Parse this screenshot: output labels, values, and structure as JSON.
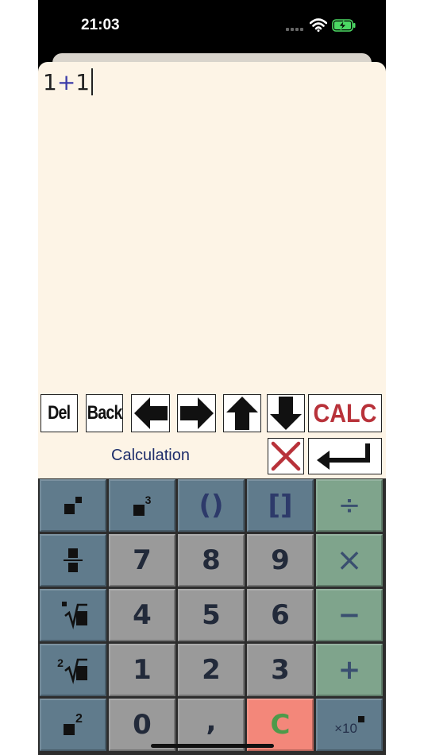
{
  "status_bar": {
    "time": "21:03"
  },
  "editor": {
    "operand_left": "1",
    "operator": "+",
    "operand_right": "1"
  },
  "toolbar": {
    "del_label": "Del",
    "back_label": "Back",
    "calc_label": "CALC"
  },
  "mode_label": "Calculation",
  "keypad": {
    "digits": [
      "7",
      "8",
      "9",
      "4",
      "5",
      "6",
      "1",
      "2",
      "3",
      "0"
    ],
    "paren_label": "()",
    "bracket_label": "[]",
    "divide_label": "÷",
    "times_label": "×",
    "minus_label": "−",
    "plus_label": "+",
    "comma_label": ",",
    "clear_label": "C",
    "cube_exponent": "3",
    "square_exponent": "2",
    "sqrt_index": "2",
    "sci_base": "×10"
  },
  "colors": {
    "editor_background": "#fdf4e6",
    "function_key": "#607b8c",
    "number_key": "#9a9a9a",
    "operator_key": "#7fa48c",
    "clear_key": "#f3877a",
    "calc_text": "#b8323a"
  }
}
